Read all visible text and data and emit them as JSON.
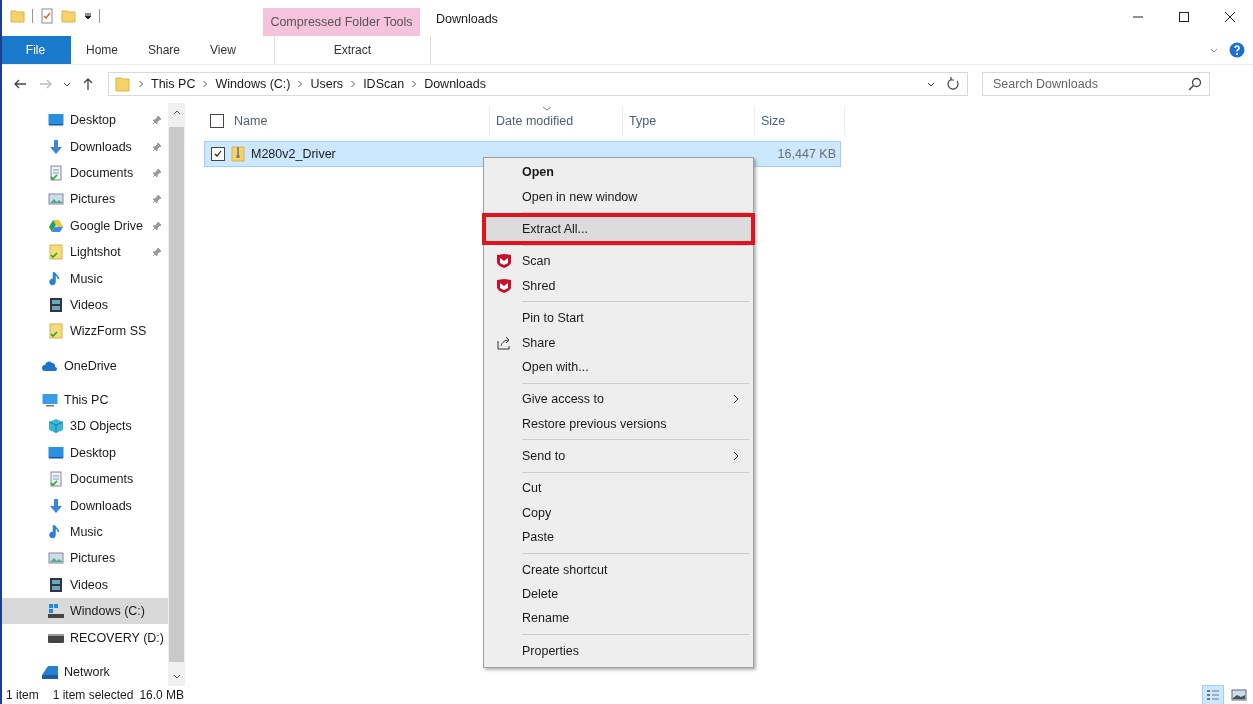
{
  "window": {
    "title": "Downloads",
    "context_tab_group": "Compressed Folder Tools"
  },
  "ribbon_tabs": [
    {
      "label": "File",
      "kind": "file",
      "selected": false
    },
    {
      "label": "Home",
      "kind": "plain",
      "selected": false
    },
    {
      "label": "Share",
      "kind": "plain",
      "selected": false
    },
    {
      "label": "View",
      "kind": "plain",
      "selected": false
    },
    {
      "label": "Extract",
      "kind": "context",
      "selected": false
    }
  ],
  "address": {
    "path": [
      "This PC",
      "Windows (C:)",
      "Users",
      "IDScan",
      "Downloads"
    ],
    "search_placeholder": "Search Downloads"
  },
  "nav": {
    "quick_access": [
      {
        "label": "Desktop",
        "kind": "desktop",
        "pinned": true,
        "selected": false
      },
      {
        "label": "Downloads",
        "kind": "downloads",
        "pinned": true,
        "selected": false
      },
      {
        "label": "Documents",
        "kind": "documents",
        "pinned": true,
        "selected": false
      },
      {
        "label": "Pictures",
        "kind": "pictures",
        "pinned": true,
        "selected": false
      },
      {
        "label": "Google Drive",
        "kind": "gdrive",
        "pinned": true,
        "selected": false
      },
      {
        "label": "Lightshot",
        "kind": "folder",
        "pinned": true,
        "selected": false
      },
      {
        "label": "Music",
        "kind": "music",
        "pinned": false,
        "selected": false
      },
      {
        "label": "Videos",
        "kind": "videos",
        "pinned": false,
        "selected": false
      },
      {
        "label": "WizzForm SS",
        "kind": "folder",
        "pinned": false,
        "selected": false
      }
    ],
    "items": [
      {
        "label": "OneDrive",
        "kind": "cloud",
        "selected": false
      },
      {
        "label": "This PC",
        "kind": "pc",
        "selected": false,
        "children": [
          {
            "label": "3D Objects",
            "kind": "cube",
            "selected": false
          },
          {
            "label": "Desktop",
            "kind": "desktop",
            "selected": false
          },
          {
            "label": "Documents",
            "kind": "documents",
            "selected": false
          },
          {
            "label": "Downloads",
            "kind": "downloads",
            "selected": false
          },
          {
            "label": "Music",
            "kind": "music",
            "selected": false
          },
          {
            "label": "Pictures",
            "kind": "pictures",
            "selected": false
          },
          {
            "label": "Videos",
            "kind": "videos",
            "selected": false
          },
          {
            "label": "Windows (C:)",
            "kind": "drive_c",
            "selected": true
          },
          {
            "label": "RECOVERY (D:)",
            "kind": "drive",
            "selected": false
          }
        ]
      },
      {
        "label": "Network",
        "kind": "network",
        "selected": false
      }
    ]
  },
  "table": {
    "columns": [
      "Name",
      "Date modified",
      "Type",
      "Size"
    ],
    "all_checked": false,
    "rows": [
      {
        "name": "M280v2_Driver",
        "size": "16,447 KB",
        "selected": true,
        "checked": true
      }
    ]
  },
  "context_menu": {
    "groups": [
      [
        {
          "label": "Open",
          "default": true
        },
        {
          "label": "Open in new window",
          "default": false
        }
      ],
      [
        {
          "label": "Extract All...",
          "default": false,
          "highlighted": true,
          "annotated": true
        }
      ],
      [
        {
          "label": "Scan",
          "default": false,
          "kind": "shield"
        },
        {
          "label": "Shred",
          "default": false,
          "kind": "shield"
        }
      ],
      [
        {
          "label": "Pin to Start",
          "default": false
        },
        {
          "label": "Share",
          "default": false,
          "kind": "share"
        },
        {
          "label": "Open with...",
          "default": false
        }
      ],
      [
        {
          "label": "Give access to",
          "default": false,
          "submenu": true
        },
        {
          "label": "Restore previous versions",
          "default": false
        }
      ],
      [
        {
          "label": "Send to",
          "default": false,
          "submenu": true
        }
      ],
      [
        {
          "label": "Cut",
          "default": false
        },
        {
          "label": "Copy",
          "default": false
        },
        {
          "label": "Paste",
          "default": false
        }
      ],
      [
        {
          "label": "Create shortcut",
          "default": false
        },
        {
          "label": "Delete",
          "default": false
        },
        {
          "label": "Rename",
          "default": false
        }
      ],
      [
        {
          "label": "Properties",
          "default": false
        }
      ]
    ]
  },
  "status_bar": {
    "count": "1 item",
    "selection": "1 item selected",
    "size": "16.0 MB"
  }
}
